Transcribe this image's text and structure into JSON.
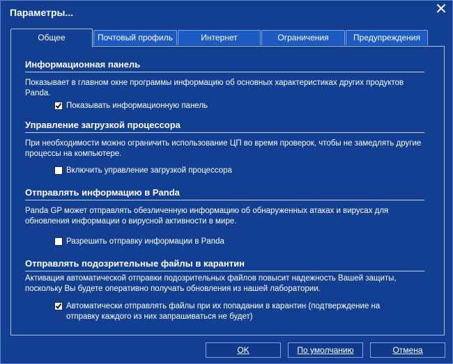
{
  "window": {
    "title": "Параметры...",
    "close_icon": "close-icon"
  },
  "tabs": [
    {
      "label": "Общее",
      "active": true
    },
    {
      "label": "Почтовый профиль",
      "active": false
    },
    {
      "label": "Интернет",
      "active": false
    },
    {
      "label": "Ограничения",
      "active": false
    },
    {
      "label": "Предупреждения",
      "active": false
    }
  ],
  "sections": [
    {
      "title": "Информационная панель",
      "description": "Показывает в главном окне программы информацию об основных характеристиках других продуктов Panda.",
      "checkbox_label": "Показывать информационную панель",
      "checked": true
    },
    {
      "title": "Управление загрузкой процессора",
      "description": "При необходимости можно ограничить использование ЦП во время проверок, чтобы не замедлять другие процессы на компьютере.",
      "checkbox_label": "Включить управление загрузкой процессора",
      "checked": false
    },
    {
      "title": "Отправлять информацию в Panda",
      "description": "Panda GP может отправлять обезличенную информацию об обнаруженных атаках и вирусах для обновления информации о вирусной активности в мире.",
      "checkbox_label": "Разрешить отправку информации в Panda",
      "checked": false
    },
    {
      "title": "Отправлять подозрительные файлы в карантин",
      "description": "Активация автоматической отправки подозрительных файлов повысит надежность Вашей защиты, поскольку Вы будете оперативно получать обновления из нашей лаборатории.",
      "checkbox_label": "Автоматически отправлять файлы при их попадании в карантин (подтверждение на отправку каждого из них запрашиваться не будет)",
      "checked": true
    }
  ],
  "buttons": {
    "ok": "OK",
    "defaults": "По умолчанию",
    "cancel": "Отмена"
  },
  "colors": {
    "background": "#123f91",
    "tab_inactive": "#1d5bc2",
    "border": "#a9c4ee"
  }
}
